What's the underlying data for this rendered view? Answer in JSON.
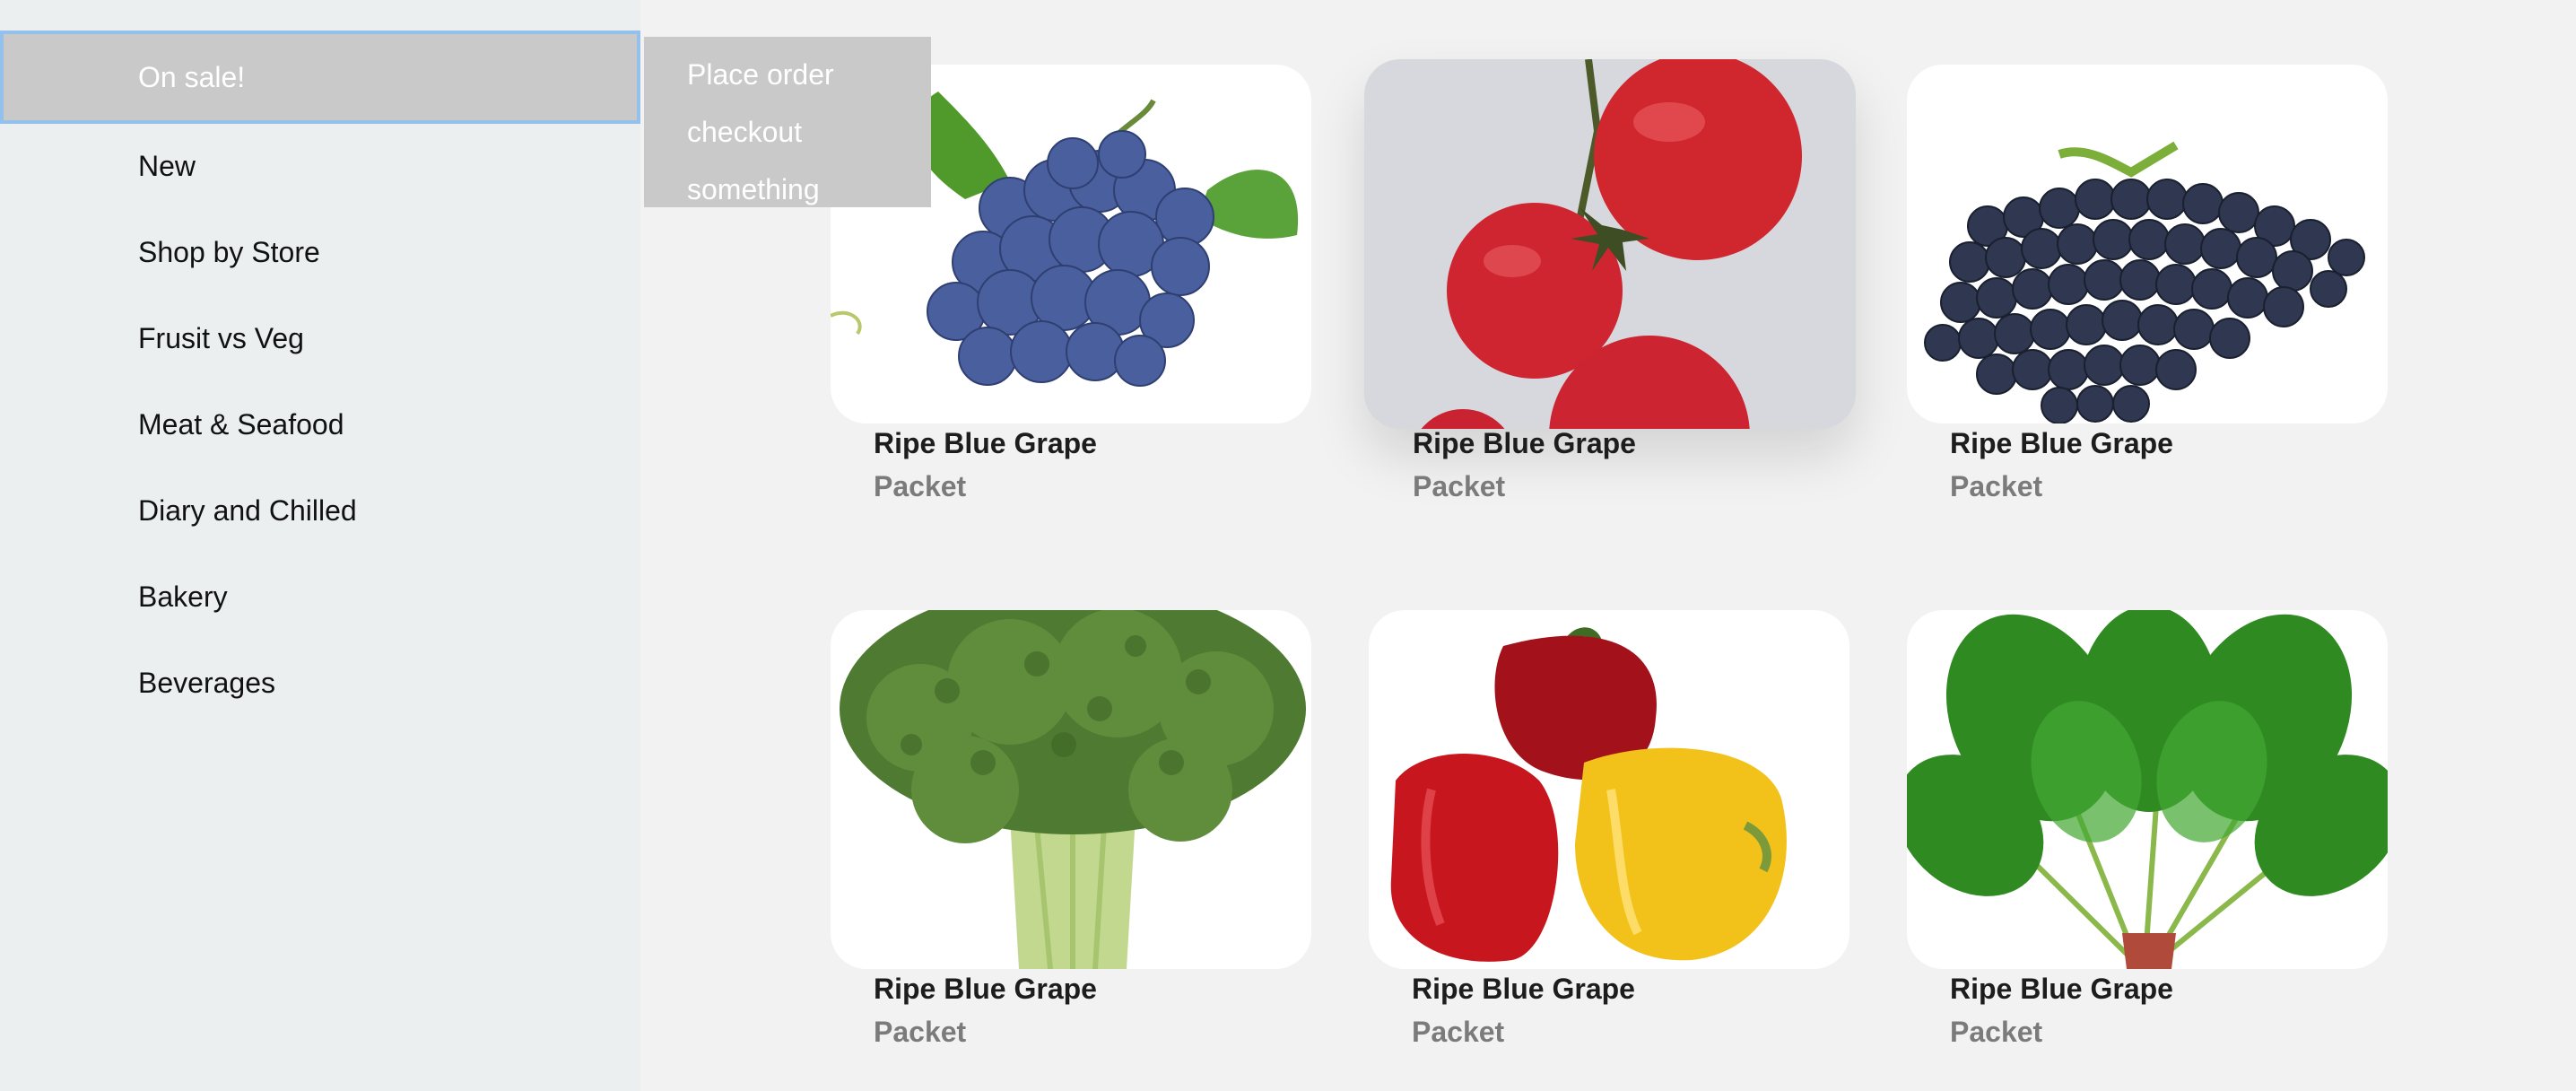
{
  "sidebar": {
    "items": [
      {
        "label": "On sale!"
      },
      {
        "label": "New"
      },
      {
        "label": "Shop by Store"
      },
      {
        "label": "Frusit vs Veg"
      },
      {
        "label": "Meat & Seafood"
      },
      {
        "label": "Diary and Chilled"
      },
      {
        "label": "Bakery"
      },
      {
        "label": "Beverages"
      }
    ]
  },
  "flyout": {
    "items": [
      {
        "label": "Place order"
      },
      {
        "label": "checkout"
      },
      {
        "label": "something"
      }
    ]
  },
  "products": [
    {
      "name": "Ripe Blue Grape",
      "unit": "Packet",
      "image": "blue-grapes-image"
    },
    {
      "name": "Ripe Blue Grape",
      "unit": "Packet",
      "image": "cherry-tomatoes-image"
    },
    {
      "name": "Ripe Blue Grape",
      "unit": "Packet",
      "image": "dark-grapes-image"
    },
    {
      "name": "Ripe Blue Grape",
      "unit": "Packet",
      "image": "broccoli-image"
    },
    {
      "name": "Ripe Blue Grape",
      "unit": "Packet",
      "image": "bell-peppers-image"
    },
    {
      "name": "Ripe Blue Grape",
      "unit": "Packet",
      "image": "spinach-image"
    }
  ],
  "colors": {
    "sidebar_bg": "#ebeff0",
    "active_bg": "#c9c9c9",
    "active_border": "#94c0ec",
    "page_bg": "#f2f2f2",
    "unit_text": "#7b7b7b"
  }
}
